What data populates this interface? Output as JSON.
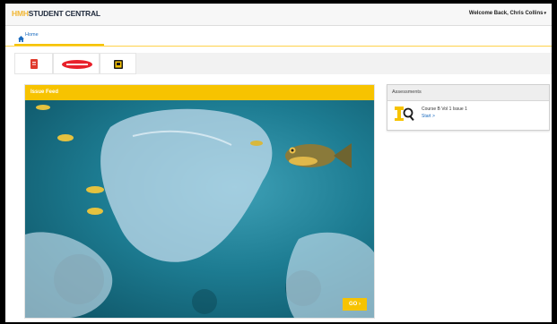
{
  "header": {
    "brand_accent": "HMH",
    "brand_main": "STUDENT CENTRAL",
    "user_menu": "Welcome Back,  Chris Collins"
  },
  "nav": {
    "home_label": "Home"
  },
  "apps": [
    {
      "name": "red-book-app-icon"
    },
    {
      "name": "read-180-app-icon"
    },
    {
      "name": "yellow-app-icon"
    }
  ],
  "issue": {
    "title": "Issue Feed",
    "go_label": "GO"
  },
  "assessments": {
    "title": "Assessments",
    "course": "Course B Vol 1 Issue 1",
    "start_label": "Start >"
  },
  "colors": {
    "brand_yellow": "#f7c300",
    "link_blue": "#1a6bbf",
    "brand_navy": "#1f2a3c"
  }
}
